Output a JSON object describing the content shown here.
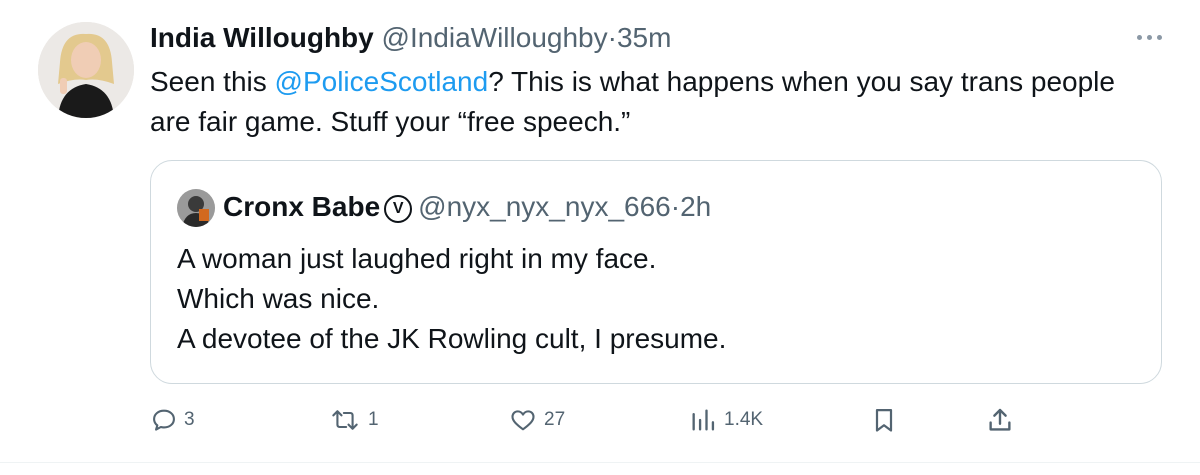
{
  "tweet": {
    "author": {
      "name": "India Willoughby",
      "handle": "@IndiaWilloughby",
      "separator": "·",
      "time": "35m"
    },
    "text": {
      "before": "Seen this ",
      "mention": "@PoliceScotland",
      "after": "? This is what happens when you say trans people are fair game. Stuff your “free speech.”"
    },
    "quote": {
      "name": "Cronx Babe",
      "badge": "V",
      "handle": "@nyx_nyx_nyx_666",
      "separator": "·",
      "time": "2h",
      "lines": [
        "A woman just laughed right in my face.",
        "Which was nice.",
        "A devotee of the JK Rowling cult, I presume."
      ]
    },
    "actions": {
      "replies": "3",
      "retweets": "1",
      "likes": "27",
      "views": "1.4K"
    },
    "icons": {
      "more": "more-icon",
      "reply": "reply-icon",
      "retweet": "retweet-icon",
      "like": "heart-icon",
      "views": "views-icon",
      "bookmark": "bookmark-icon",
      "share": "share-icon"
    },
    "colors": {
      "link": "#1d9bf0",
      "muted": "#536471",
      "text": "#0f1419",
      "border": "#cfd9de"
    }
  }
}
